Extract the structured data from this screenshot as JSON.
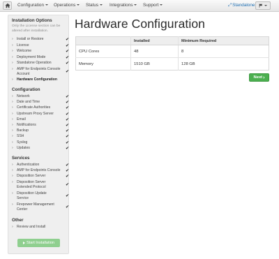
{
  "nav": {
    "items": [
      {
        "label": "Configuration"
      },
      {
        "label": "Operations"
      },
      {
        "label": "Status"
      },
      {
        "label": "Integrations"
      },
      {
        "label": "Support"
      }
    ],
    "mode_label": "Standalone"
  },
  "sidebar": {
    "install_title": "Installation Options",
    "install_note": "Only the License section can be altered after installation.",
    "install_items": [
      {
        "label": "Install or Restore"
      },
      {
        "label": "License"
      },
      {
        "label": "Welcome"
      },
      {
        "label": "Deployment Mode"
      },
      {
        "label": "Standalone Operation"
      },
      {
        "label": "AMP for Endpoints Console Account"
      },
      {
        "label": "Hardware Configuration"
      }
    ],
    "config_title": "Configuration",
    "config_items": [
      {
        "label": "Network"
      },
      {
        "label": "Date and Time"
      },
      {
        "label": "Certificate Authorities"
      },
      {
        "label": "Upstream Proxy Server"
      },
      {
        "label": "Email"
      },
      {
        "label": "Notifications"
      },
      {
        "label": "Backup"
      },
      {
        "label": "SSH"
      },
      {
        "label": "Syslog"
      },
      {
        "label": "Updates"
      }
    ],
    "services_title": "Services",
    "services_items": [
      {
        "label": "Authentication"
      },
      {
        "label": "AMP for Endpoints Console"
      },
      {
        "label": "Disposition Server"
      },
      {
        "label": "Disposition Server Extended Protocol"
      },
      {
        "label": "Disposition Update Service"
      },
      {
        "label": "Firepower Management Center"
      }
    ],
    "other_title": "Other",
    "other_items": [
      {
        "label": "Review and Install"
      }
    ],
    "start_button": "Start Installation"
  },
  "main": {
    "title": "Hardware Configuration",
    "table": {
      "headers": [
        "",
        "Installed",
        "Minimum Required"
      ],
      "rows": [
        [
          "CPU Cores",
          "48",
          "8"
        ],
        [
          "Memory",
          "1510 GB",
          "128 GB"
        ]
      ]
    },
    "next_button": "Next"
  },
  "colors": {
    "accent_green": "#4caf50",
    "start_button_green": "#8fcf8f",
    "link_blue": "#1f6fb2"
  }
}
